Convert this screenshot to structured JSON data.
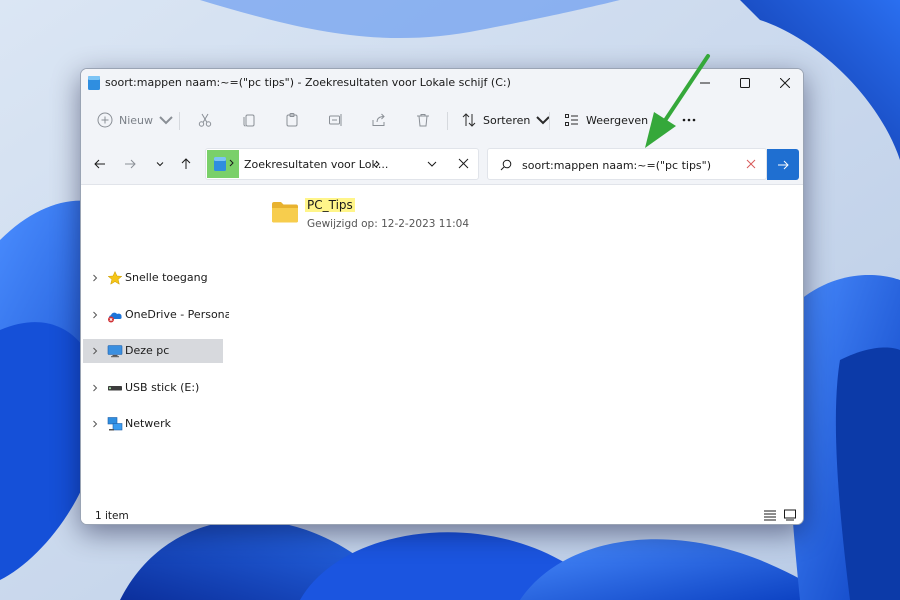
{
  "window": {
    "title": "soort:mappen naam:~=(\"pc tips\") - Zoekresultaten voor Lokale schijf (C:)"
  },
  "toolbar": {
    "new_label": "Nieuw",
    "sort_label": "Sorteren",
    "view_label": "Weergeven"
  },
  "address": {
    "path_text": "Zoekresultaten voor Lok..."
  },
  "search": {
    "value": "soort:mappen naam:~=(\"pc tips\")"
  },
  "sidebar": {
    "items": [
      {
        "label": "Snelle toegang",
        "icon": "star-icon"
      },
      {
        "label": "OneDrive - Personal",
        "icon": "onedrive-cloud-icon"
      },
      {
        "label": "Deze pc",
        "icon": "monitor-icon"
      },
      {
        "label": "USB stick (E:)",
        "icon": "usb-drive-icon"
      },
      {
        "label": "Netwerk",
        "icon": "network-icon"
      }
    ]
  },
  "results": [
    {
      "name": "PC_Tips",
      "meta_label": "Gewijzigd op:",
      "meta_value": "12-2-2023 11:04"
    }
  ],
  "status": {
    "item_count": "1 item"
  },
  "colors": {
    "accent": "#1f6fd1",
    "highlight": "#fff58a",
    "annotation_arrow": "#35a83a",
    "address_highlight": "#7ad06a"
  }
}
